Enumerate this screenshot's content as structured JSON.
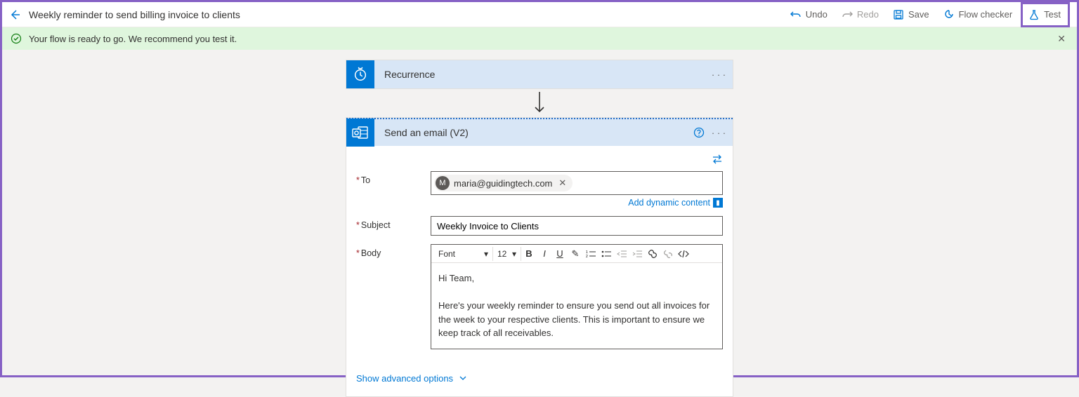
{
  "header": {
    "title": "Weekly reminder to send billing invoice to clients",
    "actions": {
      "undo": "Undo",
      "redo": "Redo",
      "save": "Save",
      "flow_checker": "Flow checker",
      "test": "Test"
    }
  },
  "banner": {
    "message": "Your flow is ready to go. We recommend you test it."
  },
  "steps": {
    "recurrence": {
      "title": "Recurrence"
    },
    "sendemail": {
      "title": "Send an email (V2)",
      "form": {
        "to_label": "To",
        "to_chip_initial": "M",
        "to_chip_email": "maria@guidingtech.com",
        "dynamic_content": "Add dynamic content",
        "subject_label": "Subject",
        "subject_value": "Weekly Invoice to Clients",
        "body_label": "Body",
        "toolbar": {
          "font_label": "Font",
          "size_label": "12"
        },
        "body_text1": "Hi Team,",
        "body_text2": "Here's your weekly reminder to ensure you send out all invoices for the week to your respective clients. This is important to ensure we keep track of all receivables.",
        "advanced": "Show advanced options"
      }
    }
  }
}
